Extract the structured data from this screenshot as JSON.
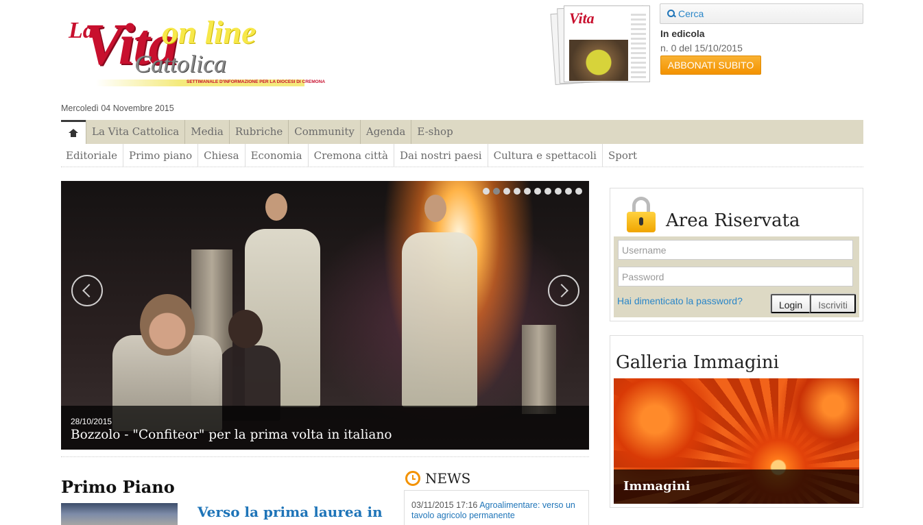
{
  "logo": {
    "la": "La",
    "vita": "Vita",
    "online": "on line",
    "cattolica": "Cattolica",
    "subtitle": "SETTIMANALE D'INFORMAZIONE PER LA DIOCESI DI CREMONA"
  },
  "paper_thumb": {
    "title": "Vita"
  },
  "search": {
    "placeholder": "Cerca",
    "icon": "search-icon"
  },
  "edicola": {
    "title": "In edicola",
    "issue": "n. 0 del 15/10/2015",
    "subscribe_label": "ABBONATI SUBITO"
  },
  "date": "Mercoledì 04 Novembre 2015",
  "nav_main": [
    "La Vita Cattolica",
    "Media",
    "Rubriche",
    "Community",
    "Agenda",
    "E-shop"
  ],
  "nav_sections": [
    "Editoriale",
    "Primo piano",
    "Chiesa",
    "Economia",
    "Cremona città",
    "Dai nostri paesi",
    "Cultura e spettacoli",
    "Sport"
  ],
  "slider": {
    "date": "28/10/2015",
    "title": "Bozzolo - \"Confiteor\" per la prima volta in italiano",
    "dot_count": 10,
    "active_dot": 1
  },
  "primo_piano": {
    "heading": "Primo Piano",
    "headline": "Verso la prima laurea in settore agroalimentare"
  },
  "news": {
    "heading": "NEWS",
    "items": [
      {
        "date": "03/11/2015 17:16",
        "text": "Agroalimentare: verso un tavolo agricolo permanente"
      }
    ]
  },
  "area_riservata": {
    "title": "Area Riservata",
    "username_placeholder": "Username",
    "password_placeholder": "Password",
    "forgot": "Hai dimenticato la password?",
    "login": "Login",
    "register": "Iscriviti"
  },
  "galleria": {
    "title": "Galleria Immagini",
    "caption": "Immagini"
  },
  "colors": {
    "brand_red": "#c8102e",
    "link_blue": "#1e74b8",
    "accent_orange": "#f39200",
    "nav_beige": "#ddd9c4"
  }
}
